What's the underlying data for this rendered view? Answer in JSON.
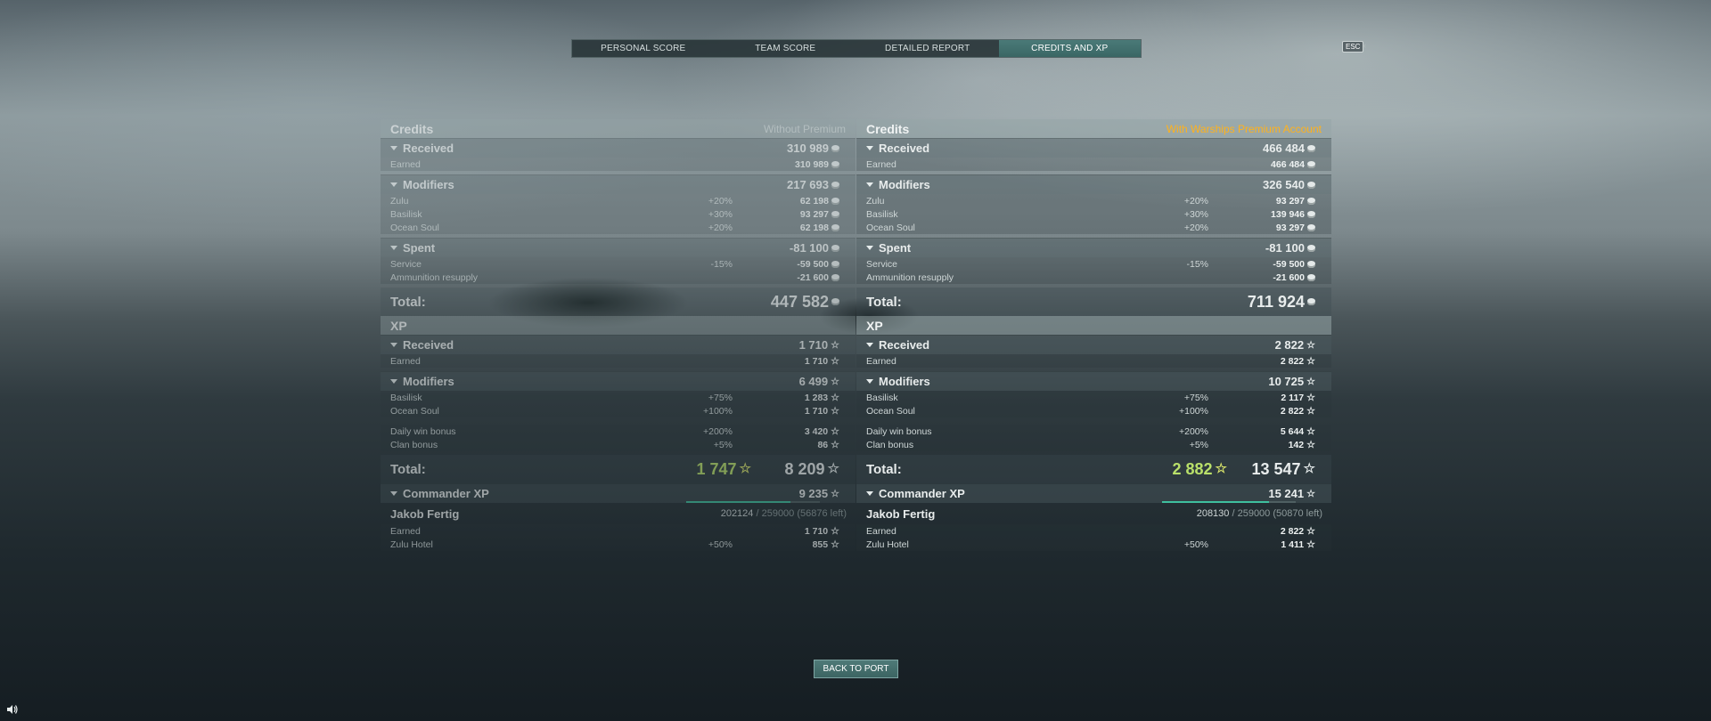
{
  "tabs": [
    {
      "label": "PERSONAL SCORE",
      "active": false
    },
    {
      "label": "TEAM SCORE",
      "active": false
    },
    {
      "label": "DETAILED REPORT",
      "active": false
    },
    {
      "label": "CREDITS AND XP",
      "active": true
    }
  ],
  "esc_label": "ESC",
  "colors": {
    "premium": "#ffb21c",
    "green_total": "#b9e06a",
    "accent": "#3fbf9e"
  },
  "left": {
    "credits_title": "Credits",
    "credits_sub": "Without Premium",
    "received": {
      "label": "Received",
      "value": "310 989"
    },
    "earned": {
      "label": "Earned",
      "value": "310 989"
    },
    "modifiers": {
      "label": "Modifiers",
      "value": "217 693"
    },
    "mods": [
      {
        "label": "Zulu",
        "pct": "+20%",
        "value": "62 198"
      },
      {
        "label": "Basilisk",
        "pct": "+30%",
        "value": "93 297"
      },
      {
        "label": "Ocean Soul",
        "pct": "+20%",
        "value": "62 198"
      }
    ],
    "spent": {
      "label": "Spent",
      "value": "-81 100"
    },
    "spent_items": [
      {
        "label": "Service",
        "pct": "-15%",
        "value": "-59 500"
      },
      {
        "label": "Ammunition resupply",
        "pct": "",
        "value": "-21 600"
      }
    ],
    "credits_total": {
      "label": "Total:",
      "value": "447 582"
    },
    "xp_title": "XP",
    "xp_received": {
      "label": "Received",
      "value": "1 710"
    },
    "xp_earned": {
      "label": "Earned",
      "value": "1 710"
    },
    "xp_modifiers": {
      "label": "Modifiers",
      "value": "6 499"
    },
    "xp_mods": [
      {
        "label": "Basilisk",
        "pct": "+75%",
        "value": "1 283"
      },
      {
        "label": "Ocean Soul",
        "pct": "+100%",
        "value": "1 710"
      }
    ],
    "xp_bonus": [
      {
        "label": "Daily win bonus",
        "pct": "+200%",
        "value": "3 420"
      },
      {
        "label": "Clan bonus",
        "pct": "+5%",
        "value": "86"
      }
    ],
    "xp_total": {
      "label": "Total:",
      "free": "1 747",
      "value": "8 209"
    },
    "cmdr": {
      "label": "Commander XP",
      "value": "9 235"
    },
    "commander": {
      "name": "Jakob Fertig",
      "current": "202124",
      "rest": " / 259000 (56876 left)",
      "progress": 0.78
    },
    "cmdr_items": [
      {
        "label": "Earned",
        "pct": "",
        "value": "1 710"
      },
      {
        "label": "Zulu Hotel",
        "pct": "+50%",
        "value": "855"
      }
    ]
  },
  "right": {
    "credits_title": "Credits",
    "credits_sub": "With Warships Premium Account",
    "received": {
      "label": "Received",
      "value": "466 484"
    },
    "earned": {
      "label": "Earned",
      "value": "466 484"
    },
    "modifiers": {
      "label": "Modifiers",
      "value": "326 540"
    },
    "mods": [
      {
        "label": "Zulu",
        "pct": "+20%",
        "value": "93 297"
      },
      {
        "label": "Basilisk",
        "pct": "+30%",
        "value": "139 946"
      },
      {
        "label": "Ocean Soul",
        "pct": "+20%",
        "value": "93 297"
      }
    ],
    "spent": {
      "label": "Spent",
      "value": "-81 100"
    },
    "spent_items": [
      {
        "label": "Service",
        "pct": "-15%",
        "value": "-59 500"
      },
      {
        "label": "Ammunition resupply",
        "pct": "",
        "value": "-21 600"
      }
    ],
    "credits_total": {
      "label": "Total:",
      "value": "711 924"
    },
    "xp_title": "XP",
    "xp_received": {
      "label": "Received",
      "value": "2 822"
    },
    "xp_earned": {
      "label": "Earned",
      "value": "2 822"
    },
    "xp_modifiers": {
      "label": "Modifiers",
      "value": "10 725"
    },
    "xp_mods": [
      {
        "label": "Basilisk",
        "pct": "+75%",
        "value": "2 117"
      },
      {
        "label": "Ocean Soul",
        "pct": "+100%",
        "value": "2 822"
      }
    ],
    "xp_bonus": [
      {
        "label": "Daily win bonus",
        "pct": "+200%",
        "value": "5 644"
      },
      {
        "label": "Clan bonus",
        "pct": "+5%",
        "value": "142"
      }
    ],
    "xp_total": {
      "label": "Total:",
      "free": "2 882",
      "value": "13 547"
    },
    "cmdr": {
      "label": "Commander XP",
      "value": "15 241"
    },
    "commander": {
      "name": "Jakob Fertig",
      "current": "208130",
      "rest": " / 259000 (50870 left)",
      "progress": 0.8
    },
    "cmdr_items": [
      {
        "label": "Earned",
        "pct": "",
        "value": "2 822"
      },
      {
        "label": "Zulu Hotel",
        "pct": "+50%",
        "value": "1 411"
      }
    ]
  },
  "back_button": "BACK TO PORT"
}
